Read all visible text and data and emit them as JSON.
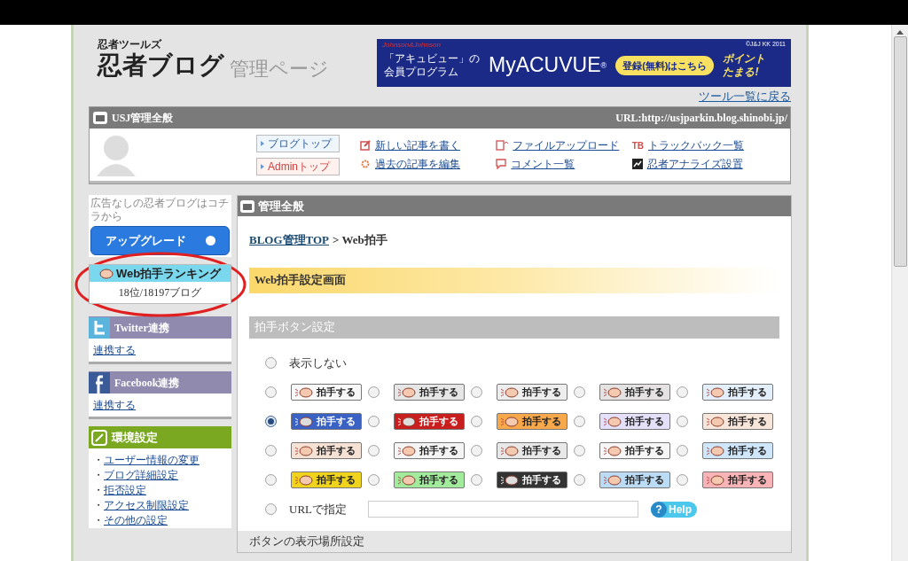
{
  "header": {
    "brand_small": "忍者ツールズ",
    "brand": "忍者ブログ",
    "brand_sub": "管理ページ",
    "tools_link": "ツール一覧に戻る"
  },
  "ad": {
    "maker": "Johnson&Johnson",
    "copyright": "©J&J KK 2011",
    "tagline": [
      "「アキュビュー」の",
      "会員プログラム"
    ],
    "product": "MyACUVUE",
    "mark": "®",
    "cta": "登録(無料)はこちら",
    "points": "ポイントたまる!"
  },
  "blog_bar": {
    "title": "USJ管理全般",
    "url": "URL:http://usjparkin.blog.shinobi.jp/"
  },
  "quick_buttons": [
    {
      "label": "ブログトップ",
      "kind": "blog"
    },
    {
      "label": "Adminトップ",
      "kind": "admin"
    }
  ],
  "quick_links": [
    {
      "label": "新しい記事を書く",
      "kind": "write"
    },
    {
      "label": "過去の記事を編集",
      "kind": "edit"
    },
    {
      "label": "ファイルアップロード",
      "kind": "upload"
    },
    {
      "label": "コメント一覧",
      "kind": "comment"
    },
    {
      "label": "トラックバック一覧",
      "kind": "trackback"
    },
    {
      "label": "忍者アナライズ設置",
      "kind": "analyze"
    }
  ],
  "trackback_mark": "TB",
  "sidebar": {
    "upgrade_note": "広告なしの忍者ブログはコチラから",
    "upgrade_button": "アップグレード",
    "ranking": {
      "title": "Web拍手ランキング",
      "value": "18位/18197ブログ"
    },
    "panels": [
      {
        "kind": "twitter",
        "title": "Twitter連携",
        "link": "連携する"
      },
      {
        "kind": "facebook",
        "title": "Facebook連携",
        "link": "連携する"
      }
    ],
    "settings": {
      "title": "環境設定",
      "bullet": "・",
      "links": [
        "ユーザー情報の変更",
        "ブログ詳細設定",
        "拒否設定",
        "アクセス制限設定",
        "その他の設定"
      ]
    }
  },
  "main": {
    "title": "管理全般",
    "breadcrumb_link": "BLOG管理TOP",
    "breadcrumb_rest": "> Web拍手",
    "page_heading": "Web拍手設定画面",
    "section": "拍手ボタン設定",
    "none_option": {
      "label": "表示しない",
      "selected": false
    },
    "button_options": [
      {
        "label": "拍手する",
        "color": "#f8f8f8",
        "selected": false
      },
      {
        "label": "拍手する",
        "color": "#e6e6e6",
        "selected": false
      },
      {
        "label": "拍手する",
        "color": "#eeeeee",
        "selected": false
      },
      {
        "label": "拍手する",
        "color": "#e4e2e2",
        "selected": false
      },
      {
        "label": "拍手する",
        "color": "#e3effb",
        "selected": false
      },
      {
        "label": "拍手する",
        "color": "#3a62c4",
        "selected": true
      },
      {
        "label": "拍手する",
        "color": "#c81e1e",
        "selected": false
      },
      {
        "label": "拍手する",
        "color": "#f6a84a",
        "selected": false
      },
      {
        "label": "拍手する",
        "color": "#e4e0fa",
        "selected": false
      },
      {
        "label": "拍手する",
        "color": "#f8e6da",
        "selected": false
      },
      {
        "label": "拍手する",
        "color": "#f6e2d4",
        "selected": false
      },
      {
        "label": "拍手する",
        "color": "#f4f4f4",
        "selected": false
      },
      {
        "label": "拍手する",
        "color": "#e8e8e8",
        "selected": false
      },
      {
        "label": "拍手する",
        "color": "#f6f6f6",
        "selected": false
      },
      {
        "label": "拍手する",
        "color": "#cfe6fb",
        "selected": false
      },
      {
        "label": "拍手する",
        "color": "#f0d31c",
        "selected": false
      },
      {
        "label": "拍手する",
        "color": "#a2ea9c",
        "selected": false
      },
      {
        "label": "拍手する",
        "color": "#333333",
        "selected": false
      },
      {
        "label": "拍手する",
        "color": "#bcdcf6",
        "selected": false
      },
      {
        "label": "拍手する",
        "color": "#f8b4b6",
        "selected": false
      }
    ],
    "url_option": {
      "label": "URLで指定",
      "selected": false
    },
    "help_mark": "?",
    "help": "Help",
    "next_section": "ボタンの表示場所設定"
  }
}
